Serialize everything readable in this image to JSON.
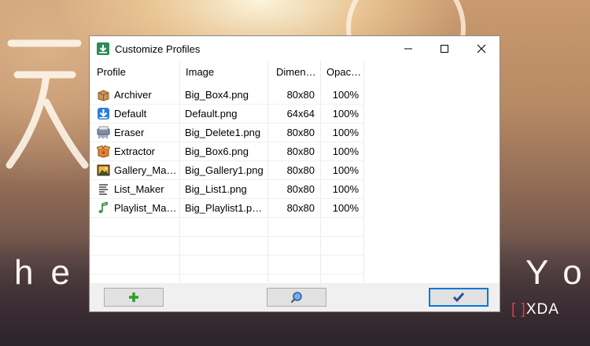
{
  "window": {
    "title": "Customize Profiles"
  },
  "columns": [
    "Profile",
    "Image",
    "Dimen…",
    "Opac…"
  ],
  "rows": [
    {
      "profile": "Archiver",
      "image": "Big_Box4.png",
      "dimensions": "80x80",
      "opacity": "100%",
      "icon": "box-icon"
    },
    {
      "profile": "Default",
      "image": "Default.png",
      "dimensions": "64x64",
      "opacity": "100%",
      "icon": "download-arrow-icon"
    },
    {
      "profile": "Eraser",
      "image": "Big_Delete1.png",
      "dimensions": "80x80",
      "opacity": "100%",
      "icon": "shredder-icon"
    },
    {
      "profile": "Extractor",
      "image": "Big_Box6.png",
      "dimensions": "80x80",
      "opacity": "100%",
      "icon": "open-box-icon"
    },
    {
      "profile": "Gallery_Ma…",
      "image": "Big_Gallery1.png",
      "dimensions": "80x80",
      "opacity": "100%",
      "icon": "picture-icon"
    },
    {
      "profile": "List_Maker",
      "image": "Big_List1.png",
      "dimensions": "80x80",
      "opacity": "100%",
      "icon": "list-document-icon"
    },
    {
      "profile": "Playlist_Ma…",
      "image": "Big_Playlist1.p…",
      "dimensions": "80x80",
      "opacity": "100%",
      "icon": "music-note-icon"
    }
  ],
  "buttons": {
    "add": "plus-icon",
    "preview": "magnifier-icon",
    "ok": "checkmark-icon"
  },
  "background": {
    "left_text": "he",
    "right_text": "Yo",
    "watermark": "XDA"
  }
}
